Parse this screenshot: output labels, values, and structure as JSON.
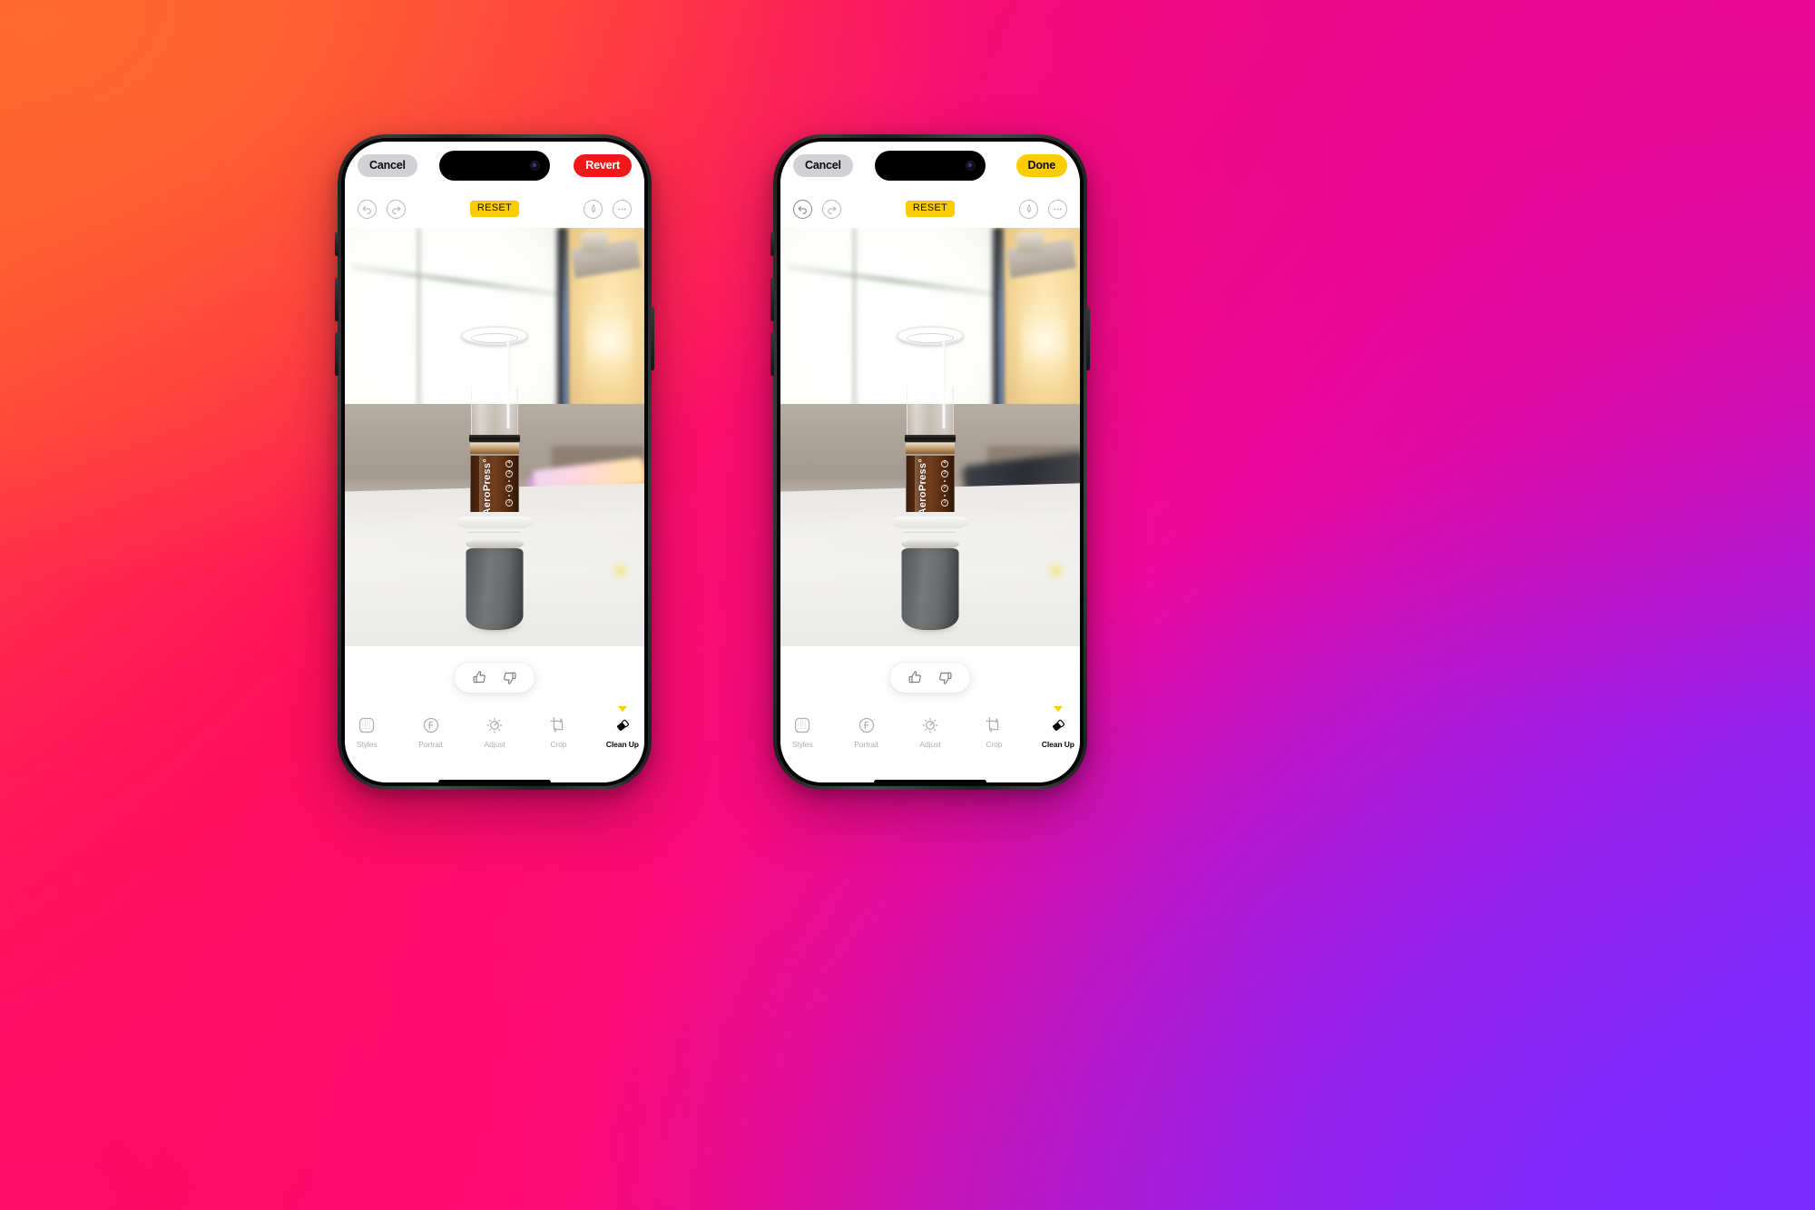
{
  "scene": {
    "description": "Two iPhone mockups side by side on an orange-to-pink-to-violet gradient background, showing Apple Photos Clean Up before and after",
    "background_colors": {
      "top_left": "#FF6A2E",
      "top_right": "#E8078F",
      "bottom_left": "#FF0A66",
      "bottom_right": "#7B2BFF"
    },
    "accent_yellow": "#FFCC00",
    "revert_red": "#F01818",
    "cancel_gray": "#D1D1D6"
  },
  "phones": [
    {
      "id": "before",
      "navbar": {
        "cancel_label": "Cancel",
        "primary_label": "Revert",
        "primary_style": "revert"
      },
      "edittools": {
        "undo_icon": "undo-icon",
        "redo_icon": "redo-icon",
        "undo_enabled": false,
        "redo_enabled": false,
        "reset_label": "RESET",
        "markup_icon": "markup-pen-icon",
        "more_icon": "more-options-icon"
      },
      "photo": {
        "subject": "AeroPress coffee maker on a white counter",
        "brand_text": "AeroPress°",
        "scale_marks": [
          "1",
          "2",
          "3",
          "4"
        ],
        "cleaned": false
      },
      "feedback": {
        "thumbs_up_icon": "thumbs-up-icon",
        "thumbs_down_icon": "thumbs-down-icon"
      },
      "tabs": [
        {
          "label": "Styles",
          "icon": "styles-grid-icon",
          "active": false
        },
        {
          "label": "Portrait",
          "icon": "portrait-f-icon",
          "active": false
        },
        {
          "label": "Adjust",
          "icon": "adjust-dial-icon",
          "active": false
        },
        {
          "label": "Crop",
          "icon": "crop-icon",
          "active": false
        },
        {
          "label": "Clean Up",
          "icon": "clean-up-eraser-icon",
          "active": true
        }
      ]
    },
    {
      "id": "after",
      "navbar": {
        "cancel_label": "Cancel",
        "primary_label": "Done",
        "primary_style": "done"
      },
      "edittools": {
        "undo_icon": "undo-icon",
        "redo_icon": "redo-icon",
        "undo_enabled": true,
        "redo_enabled": false,
        "reset_label": "RESET",
        "markup_icon": "markup-pen-icon",
        "more_icon": "more-options-icon"
      },
      "photo": {
        "subject": "AeroPress coffee maker on a white counter with background object removed",
        "brand_text": "AeroPress°",
        "scale_marks": [
          "1",
          "2",
          "3",
          "4"
        ],
        "cleaned": true
      },
      "feedback": {
        "thumbs_up_icon": "thumbs-up-icon",
        "thumbs_down_icon": "thumbs-down-icon"
      },
      "tabs": [
        {
          "label": "Styles",
          "icon": "styles-grid-icon",
          "active": false
        },
        {
          "label": "Portrait",
          "icon": "portrait-f-icon",
          "active": false
        },
        {
          "label": "Adjust",
          "icon": "adjust-dial-icon",
          "active": false
        },
        {
          "label": "Crop",
          "icon": "crop-icon",
          "active": false
        },
        {
          "label": "Clean Up",
          "icon": "clean-up-eraser-icon",
          "active": true
        }
      ]
    }
  ]
}
